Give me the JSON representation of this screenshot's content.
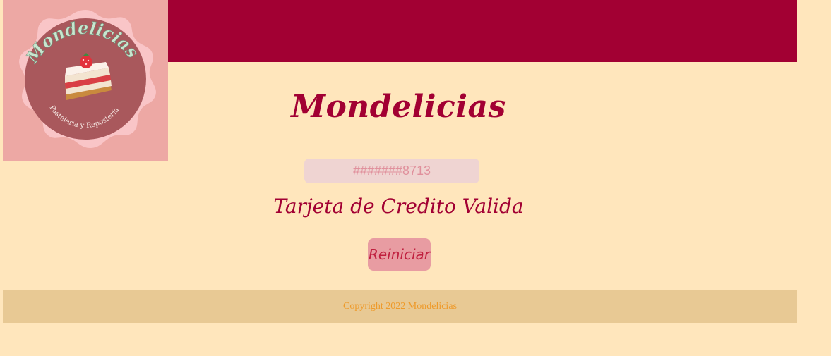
{
  "header": {
    "logo": {
      "brand_text": "Mondelicias",
      "tagline": "Pastelería y Repostería",
      "icon": "cake-slice-icon"
    },
    "title": "Mondelicias"
  },
  "main": {
    "card_input": {
      "value": "#######8713"
    },
    "result_text": "Tarjeta de Credito Valida",
    "reset_button_label": "Reiniciar"
  },
  "footer": {
    "copyright": "Copyright 2022 Mondelicias"
  },
  "colors": {
    "background": "#FFE6BC",
    "header": "#A20033",
    "logo_background": "#EDA8A4",
    "input_background": "#EFD4D2",
    "button_background": "#E89CA2",
    "footer_background": "#E8C994",
    "footer_text": "#EE9A2A"
  }
}
